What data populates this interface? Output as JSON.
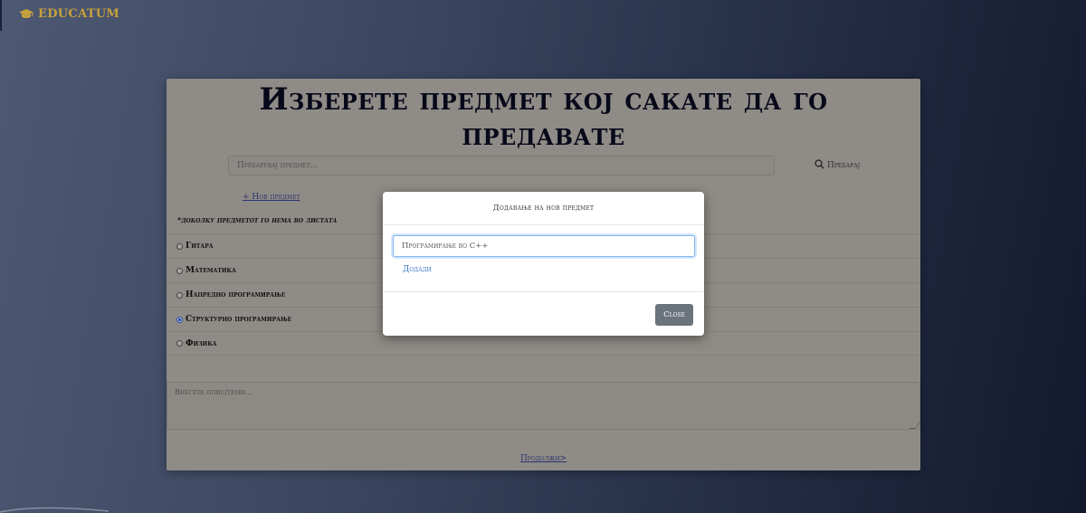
{
  "nav": {
    "brand": "EDUCATUM",
    "brand_color": "#c8a23a"
  },
  "page": {
    "title": "Изберете предмет кој сакате да го предавате",
    "search_placeholder": "Пребарувај предмет...",
    "search_button": "Пребарај",
    "new_subject_link": "+ Нов предмет",
    "note": "*доколку предметот го нема во листата",
    "subjects": [
      {
        "label": "Гитара",
        "checked": false
      },
      {
        "label": "Математика",
        "checked": false
      },
      {
        "label": "Напредно програмирање",
        "checked": false
      },
      {
        "label": "Структурно програмирање",
        "checked": true
      },
      {
        "label": "Физика",
        "checked": false
      }
    ],
    "description_placeholder": "Внесете опис/теми...",
    "continue_link": "Продолжи>"
  },
  "modal": {
    "title": "Додавање на нов предмет",
    "input_value": "Програмирање во C++",
    "add_link": "Додади",
    "close_button": "Close"
  },
  "icons": {
    "brand": "graduation-cap-icon",
    "search": "magnifier-icon"
  }
}
